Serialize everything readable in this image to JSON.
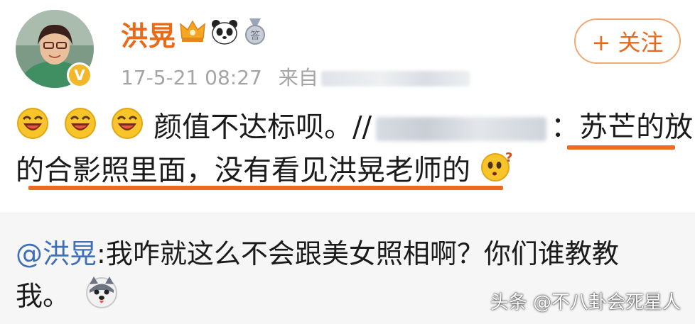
{
  "post": {
    "username": "洪晃",
    "verified_badge": "V",
    "timestamp": "17-5-21 08:27",
    "source_prefix": "来自",
    "follow_button": {
      "plus": "+",
      "label": "关注"
    },
    "badges": [
      "crown-badge-icon",
      "panda-badge-icon",
      "medal-badge-icon"
    ],
    "medal_text": "答",
    "text_line1_main": "颜值不达标呗。//",
    "text_line1_colon": "：",
    "text_line1_tail": "苏芒的放",
    "text_line2": "的合影照里面，没有看见洪晃老师的",
    "emojis": [
      "laughing-emoji-icon",
      "laughing-emoji-icon",
      "laughing-emoji-icon",
      "thinking-emoji-icon"
    ],
    "highlight_color": "#ee6a1e",
    "name_color": "#e86b1a"
  },
  "repost": {
    "mention": "@洪晃",
    "text": ":我咋就这么不会跟美女照相啊？你们谁教教",
    "text_line2": "我。",
    "emoji": "husky-emoji-icon",
    "mention_color": "#3f6fb6"
  },
  "watermark": "头条 @不八卦会死星人"
}
